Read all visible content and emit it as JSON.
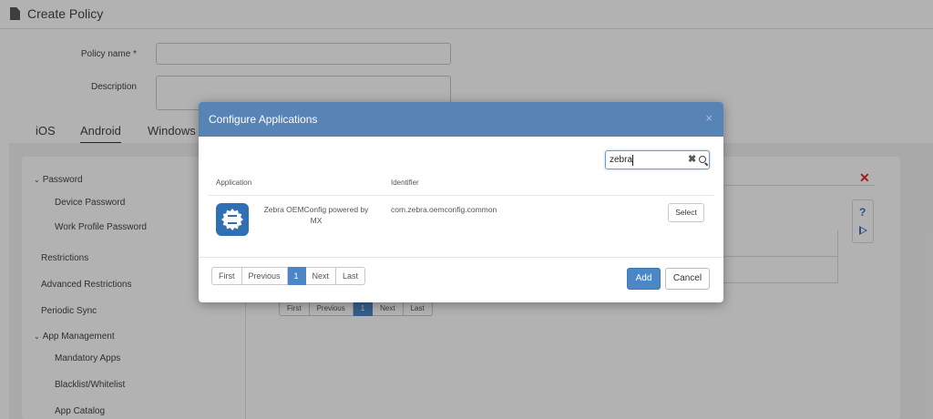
{
  "page": {
    "title": "Create Policy",
    "form": {
      "policy_name_label": "Policy name *",
      "policy_name_value": "",
      "description_label": "Description",
      "description_value": ""
    },
    "os_tabs": [
      {
        "label": "iOS",
        "active": false
      },
      {
        "label": "Android",
        "active": true
      },
      {
        "label": "Windows",
        "active": false
      }
    ],
    "sidebar": {
      "password_group": "Password",
      "device_password": "Device Password",
      "work_profile_password": "Work Profile Password",
      "restrictions": "Restrictions",
      "advanced_restrictions": "Advanced Restrictions",
      "periodic_sync": "Periodic Sync",
      "app_management_group": "App Management",
      "mandatory_apps": "Mandatory Apps",
      "blacklist_whitelist": "Blacklist/Whitelist",
      "app_catalog": "App Catalog"
    },
    "help_icon": "?",
    "background_pager": [
      "First",
      "Previous",
      "1",
      "Next",
      "Last"
    ]
  },
  "modal": {
    "title": "Configure Applications",
    "close_glyph": "×",
    "search": {
      "value": "zebra",
      "clear_glyph": "✖"
    },
    "columns": {
      "application": "Application",
      "identifier": "Identifier"
    },
    "rows": [
      {
        "icon": "zebra-oemconfig-gear-icon",
        "name": "Zebra OEMConfig powered by MX",
        "identifier": "com.zebra.oemconfig.common",
        "action": "Select"
      }
    ],
    "pager": [
      "First",
      "Previous",
      "1",
      "Next",
      "Last"
    ],
    "active_page": "1",
    "add_label": "Add",
    "cancel_label": "Cancel"
  },
  "colors": {
    "header_blue": "#5883b5",
    "primary_button": "#4b86c6",
    "danger_red": "#e22a2a"
  }
}
